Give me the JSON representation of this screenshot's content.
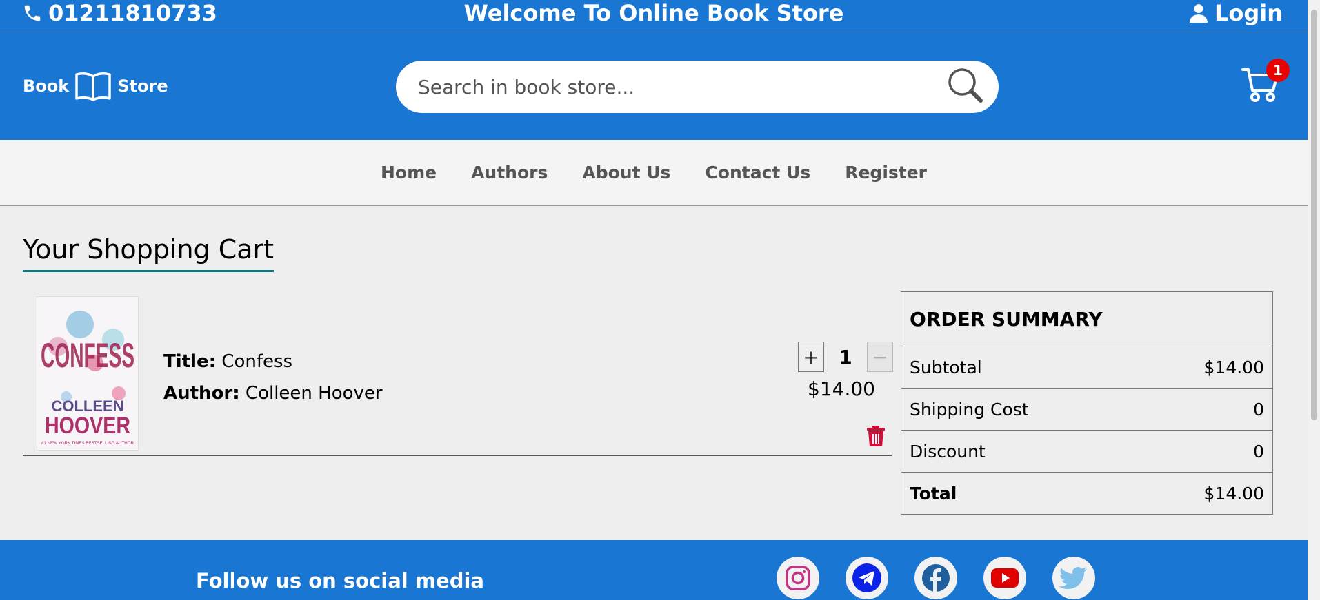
{
  "topbar": {
    "phone": "01211810733",
    "welcome": "Welcome To Online Book Store",
    "login": "Login"
  },
  "header": {
    "logo_left": "Book",
    "logo_right": "Store",
    "search_placeholder": "Search in book store...",
    "cart_count": "1"
  },
  "nav": {
    "items": [
      "Home",
      "Authors",
      "About Us",
      "Contact Us",
      "Register"
    ]
  },
  "cart": {
    "title": "Your Shopping Cart",
    "item": {
      "title_label": "Title:",
      "title": "Confess",
      "author_label": "Author:",
      "author": "Colleen Hoover",
      "quantity": "1",
      "price": "$14.00",
      "plus": "+",
      "minus": "−"
    },
    "cover": {
      "title": "CONFESS",
      "author_first": "COLLEEN",
      "author_last": "HOOVER",
      "tag": "#1 NEW YORK TIMES BESTSELLING AUTHOR"
    }
  },
  "summary": {
    "heading": "ORDER SUMMARY",
    "rows": [
      {
        "label": "Subtotal",
        "value": "$14.00"
      },
      {
        "label": "Shipping Cost",
        "value": "0"
      },
      {
        "label": "Discount",
        "value": "0"
      },
      {
        "label": "Total",
        "value": "$14.00"
      }
    ]
  },
  "footer": {
    "follow": "Follow us on social media",
    "social": [
      "instagram-icon",
      "telegram-icon",
      "facebook-icon",
      "youtube-icon",
      "twitter-icon"
    ]
  },
  "colors": {
    "primary": "#1976d2",
    "badge": "#e90000",
    "underline": "#0a7a86",
    "trash": "#d0103a"
  }
}
